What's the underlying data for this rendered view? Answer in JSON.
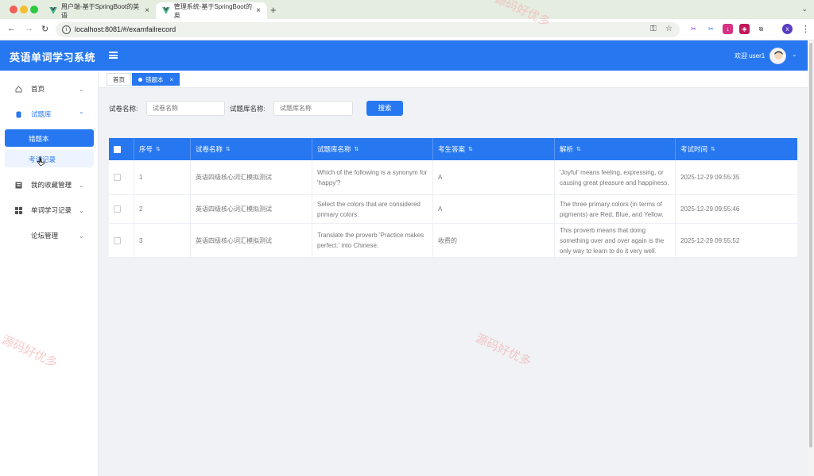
{
  "browser": {
    "tabs": [
      {
        "label": "用户端-基于SpringBoot的英语",
        "active": false
      },
      {
        "label": "管理系统-基于SpringBoot的英",
        "active": true
      }
    ],
    "new_tab": "+",
    "url": "localhost:8081/#/examfailrecord"
  },
  "app": {
    "title": "英语单词学习系统",
    "welcome": "欢迎 user1",
    "accent": "#2778f0"
  },
  "sidebar": {
    "items": [
      {
        "label": "首页",
        "icon": "home-icon"
      },
      {
        "label": "试题库",
        "icon": "quiz-icon",
        "open": true
      },
      {
        "label": "我的收藏管理",
        "icon": "collection-icon"
      },
      {
        "label": "单词学习记录",
        "icon": "grid-icon"
      },
      {
        "label": "论坛管理",
        "icon": ""
      }
    ],
    "sub_items": [
      {
        "label": "错题本",
        "active": true
      },
      {
        "label": "考试记录",
        "active": false
      }
    ]
  },
  "tags": [
    {
      "label": "首页"
    },
    {
      "label": "错题本",
      "active": true,
      "close": "×"
    }
  ],
  "search": {
    "paper_label": "试卷名称:",
    "paper_placeholder": "试卷名称",
    "bank_label": "试题库名称:",
    "bank_placeholder": "试题库名称",
    "button": "搜索"
  },
  "table": {
    "headers": [
      "序号",
      "试卷名称",
      "试题库名称",
      "考生答案",
      "解析",
      "考试时间"
    ],
    "rows": [
      {
        "index": "1",
        "paper": "英语四级核心词汇模拟测试",
        "question": "Which of the following is a synonym for 'happy'?",
        "answer": "A",
        "analysis": "'Joyful' means feeling, expressing, or causing great pleasure and happiness.",
        "time": "2025-12-29 09:55:35"
      },
      {
        "index": "2",
        "paper": "英语四级核心词汇模拟测试",
        "question": "Select the colors that are considered primary colors.",
        "answer": "A",
        "analysis": "The three primary colors (in terms of pigments) are Red, Blue, and Yellow.",
        "time": "2025-12-29 09:55:46"
      },
      {
        "index": "3",
        "paper": "英语四级核心词汇模拟测试",
        "question": "Translate the proverb 'Practice makes perfect.' into Chinese.",
        "answer": "收费的",
        "analysis": "This proverb means that doing something over and over again is the only way to learn to do it very well.",
        "time": "2025-12-29 09:55:52"
      }
    ]
  },
  "watermark": "源码好优多"
}
